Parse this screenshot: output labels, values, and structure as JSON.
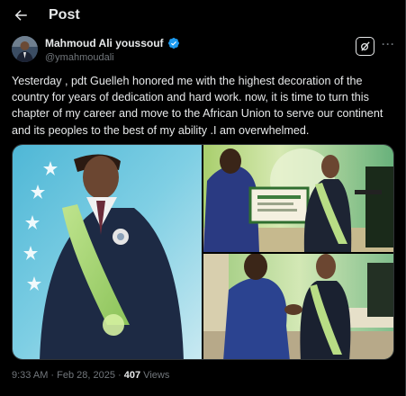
{
  "header": {
    "title": "Post",
    "back_icon": "arrow-left-icon"
  },
  "author": {
    "name": "Mahmoud Ali youssouf",
    "handle": "@ymahmoudali",
    "verified_icon": "verified-badge-icon",
    "verified_color": "#1d9bf0"
  },
  "actions": {
    "grok_icon": "grok-icon",
    "more_icon": "more-icon",
    "more_label": "···"
  },
  "post": {
    "text": "Yesterday , pdt Guelleh honored me with the highest decoration of the country for years of dedication and hard work. now, it is time to turn this chapter of my career and move to the African Union to serve our continent and its peoples to the best of my ability .I am overwhelmed."
  },
  "media": {
    "photos": [
      "photo-portrait-with-sash",
      "photo-certificate-presentation",
      "photo-handshake-ceremony"
    ]
  },
  "meta": {
    "time": "9:33 AM",
    "sep1": " · ",
    "date": "Feb 28, 2025",
    "sep2": " · ",
    "views": "407",
    "views_label": " Views"
  },
  "colors": {
    "background": "#000000",
    "text": "#e7e9ea",
    "muted": "#71767b",
    "border": "#2f3336"
  }
}
